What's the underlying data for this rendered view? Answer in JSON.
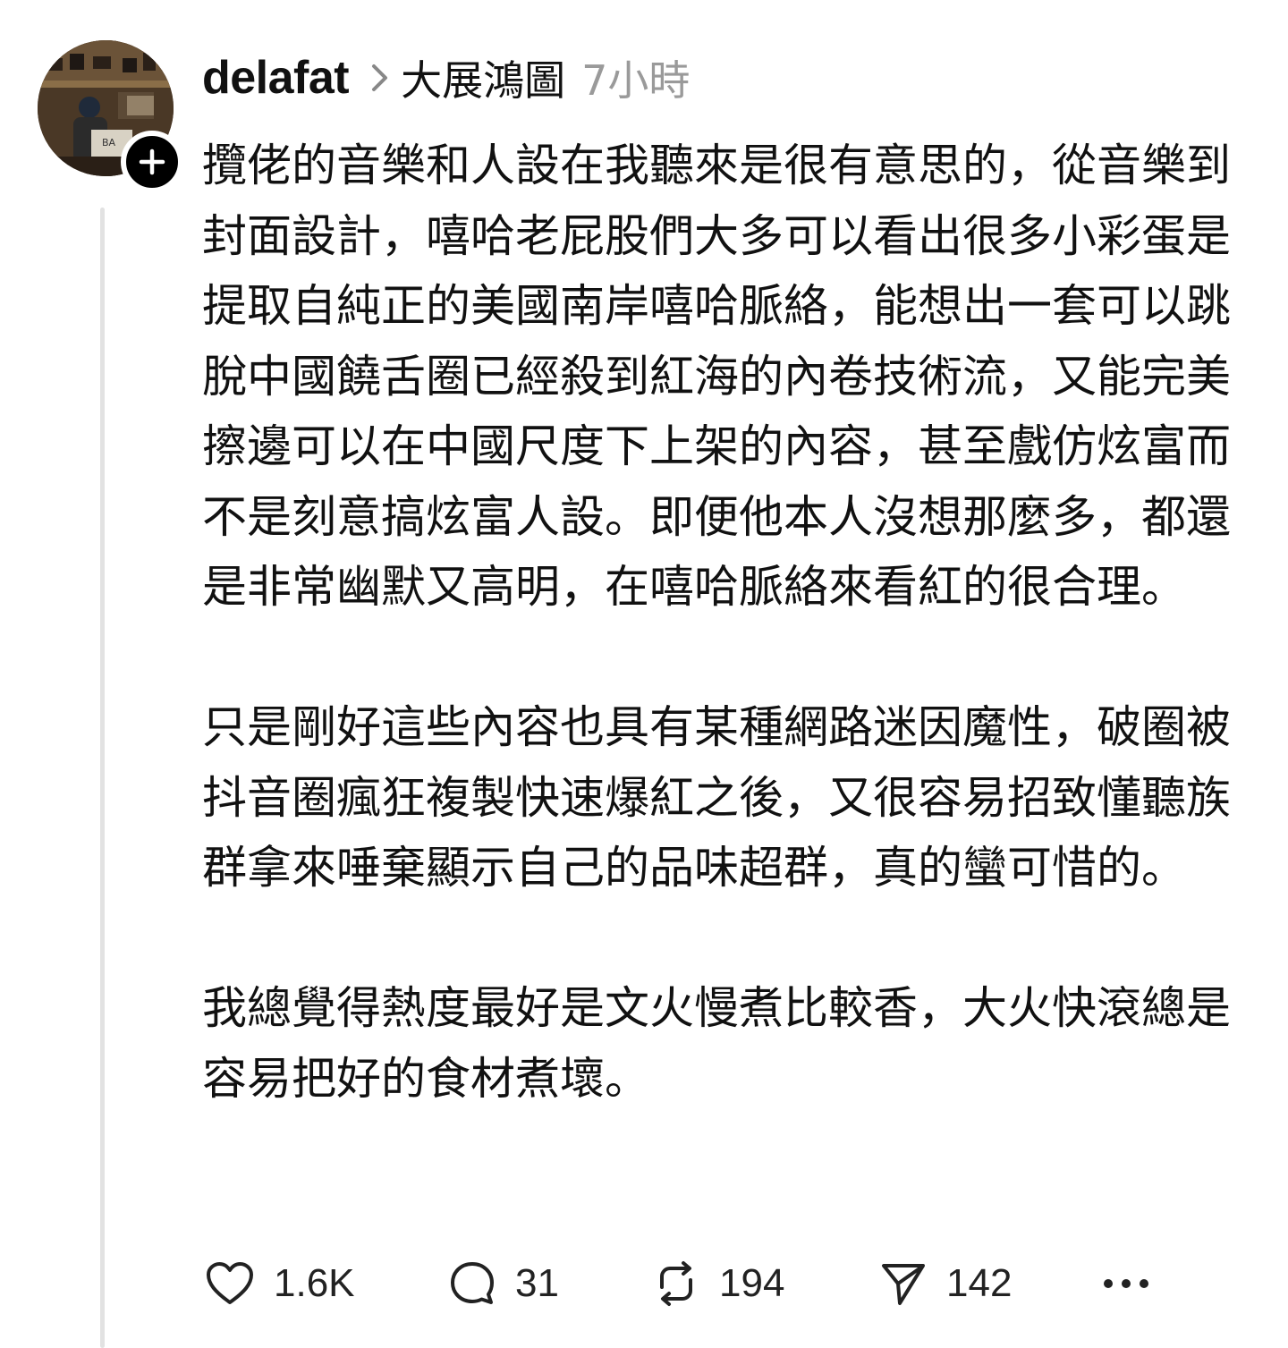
{
  "post": {
    "username": "delafat",
    "topic": "大展鴻圖",
    "timestamp": "7小時",
    "paragraphs": [
      "攬佬的音樂和人設在我聽來是很有意思的，從音樂到封面設計，嘻哈老屁股們大多可以看出很多小彩蛋是提取自純正的美國南岸嘻哈脈絡，能想出一套可以跳脫中國饒舌圈已經殺到紅海的內卷技術流，又能完美擦邊可以在中國尺度下上架的內容，甚至戲仿炫富而不是刻意搞炫富人設。即便他本人沒想那麼多，都還是非常幽默又高明，在嘻哈脈絡來看紅的很合理。",
      "只是剛好這些內容也具有某種網路迷因魔性，破圈被抖音圈瘋狂複製快速爆紅之後，又很容易招致懂聽族群拿來唾棄顯示自己的品味超群，真的蠻可惜的。",
      "我總覺得熱度最好是文火慢煮比較香，大火快滾總是容易把好的食材煮壞。"
    ]
  },
  "actions": {
    "likes": "1.6K",
    "replies": "31",
    "reposts": "194",
    "shares": "142"
  },
  "icons": {
    "like": "heart-icon",
    "reply": "speech-bubble-icon",
    "repost": "repost-icon",
    "share": "send-icon",
    "more": "more-dots-icon",
    "follow": "plus-icon",
    "chevron": "chevron-right-icon"
  },
  "colors": {
    "text": "#111111",
    "muted": "#9a9a9a",
    "thread_line": "#e2e2e2",
    "badge": "#000000"
  }
}
